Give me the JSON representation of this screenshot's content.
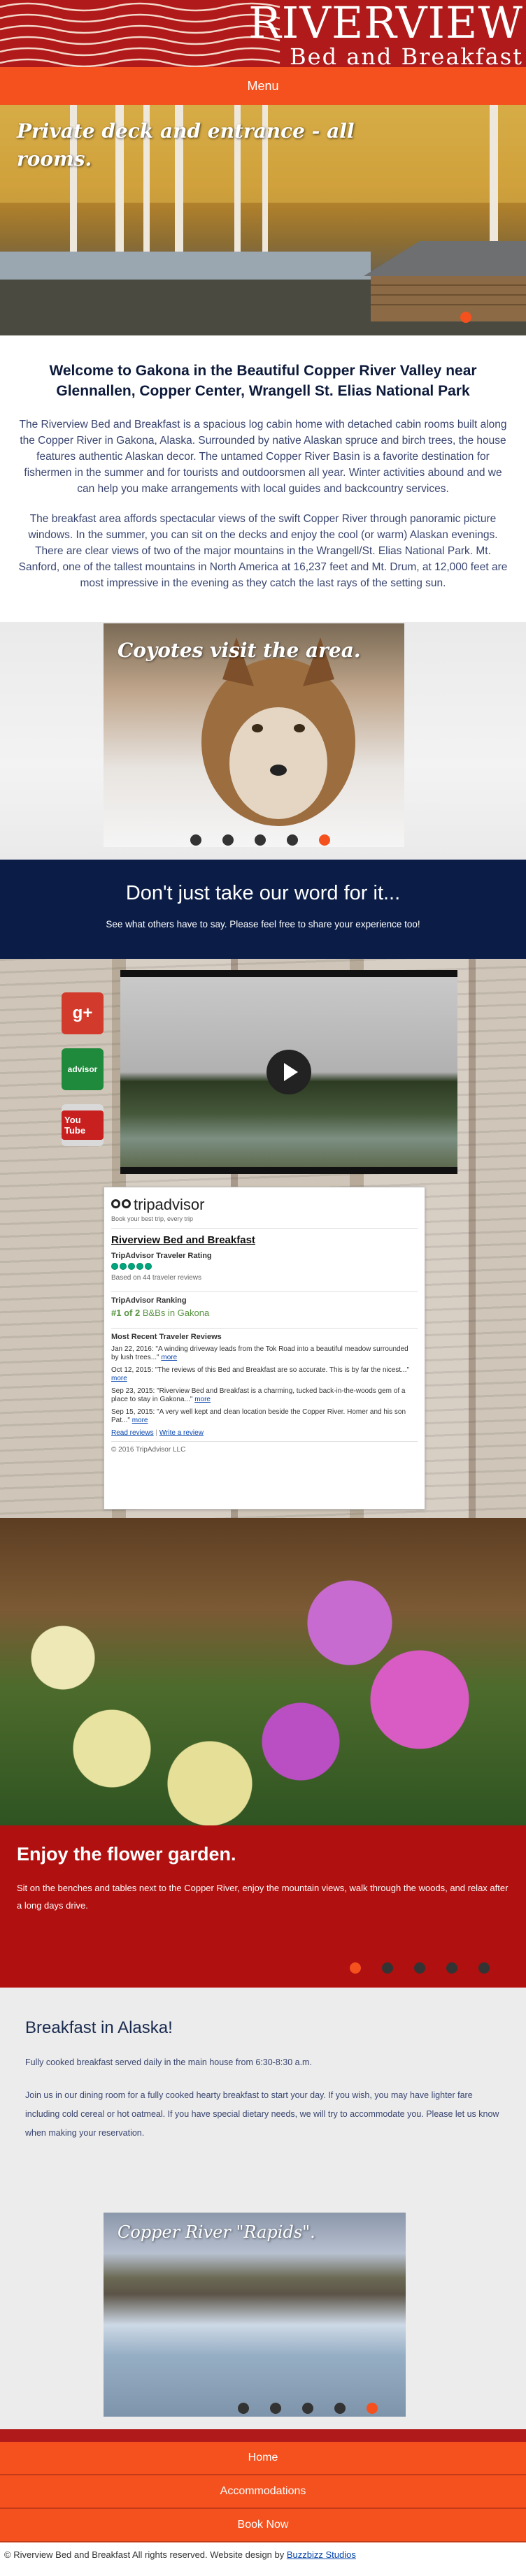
{
  "header": {
    "logo_title": "RIVERVIEW",
    "logo_subtitle": "Bed and Breakfast",
    "menu_label": "Menu"
  },
  "hero": {
    "caption": "Private deck and entrance - all rooms."
  },
  "intro": {
    "title": "Welcome to Gakona in the Beautiful Copper River Valley near Glennallen, Copper Center, Wrangell St. Elias National Park",
    "p1": "The Riverview Bed and Breakfast is a spacious log cabin home with detached cabin rooms built along the Copper River in Gakona, Alaska. Surrounded by native Alaskan spruce and birch trees, the house features authentic Alaskan decor. The untamed Copper River Basin is a favorite destination for fishermen in the summer and for tourists and outdoorsmen all year. Winter activities abound and we can help you make arrangements with local guides and backcountry services.",
    "p2": "The breakfast area affords spectacular views of the swift Copper River through panoramic picture windows. In the summer, you can sit on the decks and enjoy the cool (or warm) Alaskan evenings. There are clear views of two of the major mountains in the Wrangell/St. Elias National Park. Mt. Sanford, one of the tallest mountains in North America at 16,237 feet and Mt. Drum, at 12,000 feet are most impressive in the evening as they catch the last rays of the setting sun."
  },
  "coyote_slider": {
    "caption": "Coyotes visit the area.",
    "slide_count": 5,
    "active_index": 4
  },
  "reviews": {
    "title": "Don't just take our word for it...",
    "subtitle": "See what others have to say. Please feel free to share your experience too!"
  },
  "social": {
    "gplus_label": "g+",
    "tripadvisor_label": "advisor",
    "youtube_label": "You Tube"
  },
  "tripadvisor": {
    "logo": "tripadvisor",
    "tagline": "Book your best trip, every trip",
    "business_name": "Riverview Bed and Breakfast",
    "rating_heading": "TripAdvisor Traveler Rating",
    "rating_value": 5,
    "based_on": "Based on 44 traveler reviews",
    "ranking_heading": "TripAdvisor Ranking",
    "ranking_number": "#1 of 2",
    "ranking_text": "B&Bs in Gakona",
    "recent_heading": "Most Recent Traveler Reviews",
    "reviews": [
      {
        "date": "Jan 22, 2016:",
        "text": "\"A winding driveway leads from the Tok Road into a beautiful meadow surrounded by lush trees...\"",
        "more": "more"
      },
      {
        "date": "Oct 12, 2015:",
        "text": "\"The reviews of this Bed and Breakfast are so accurate. This is by far the nicest...\"",
        "more": "more"
      },
      {
        "date": "Sep 23, 2015:",
        "text": "\"Riverview Bed and Breakfast is a charming, tucked back-in-the-woods gem of a place to stay in Gakona...\"",
        "more": "more"
      },
      {
        "date": "Sep 15, 2015:",
        "text": "\"A very well kept and clean location beside the Copper River. Homer and his son Pat...\"",
        "more": "more"
      }
    ],
    "read_reviews": "Read reviews",
    "write_review": "Write a review",
    "copyright": "© 2016 TripAdvisor LLC"
  },
  "flowers": {
    "title": "Enjoy the flower garden.",
    "text": "Sit on the benches and tables next to the Copper River, enjoy the mountain views, walk through the woods, and relax after a long days drive.",
    "slide_count": 5,
    "active_index": 0
  },
  "breakfast": {
    "title": "Breakfast in Alaska!",
    "p1": "Fully cooked breakfast served daily in the main house from 6:30-8:30 a.m.",
    "p2": "Join us in our dining room for a fully cooked hearty breakfast to start your day. If you wish, you may have lighter fare including cold cereal or hot oatmeal. If you have special dietary needs, we will try to accommodate you. Please let us know when making your reservation.",
    "slide_caption": "Copper River \"Rapids\".",
    "slide_count": 5,
    "active_index": 4
  },
  "footer": {
    "nav": [
      "Home",
      "Accommodations",
      "Book Now"
    ],
    "copyright": "© Riverview Bed and Breakfast All rights reserved. Website design by",
    "designer": "Buzzbizz Studios"
  },
  "colors": {
    "brand_red": "#b01a1a",
    "accent_orange": "#f4511e",
    "navy": "#0b1d47"
  }
}
